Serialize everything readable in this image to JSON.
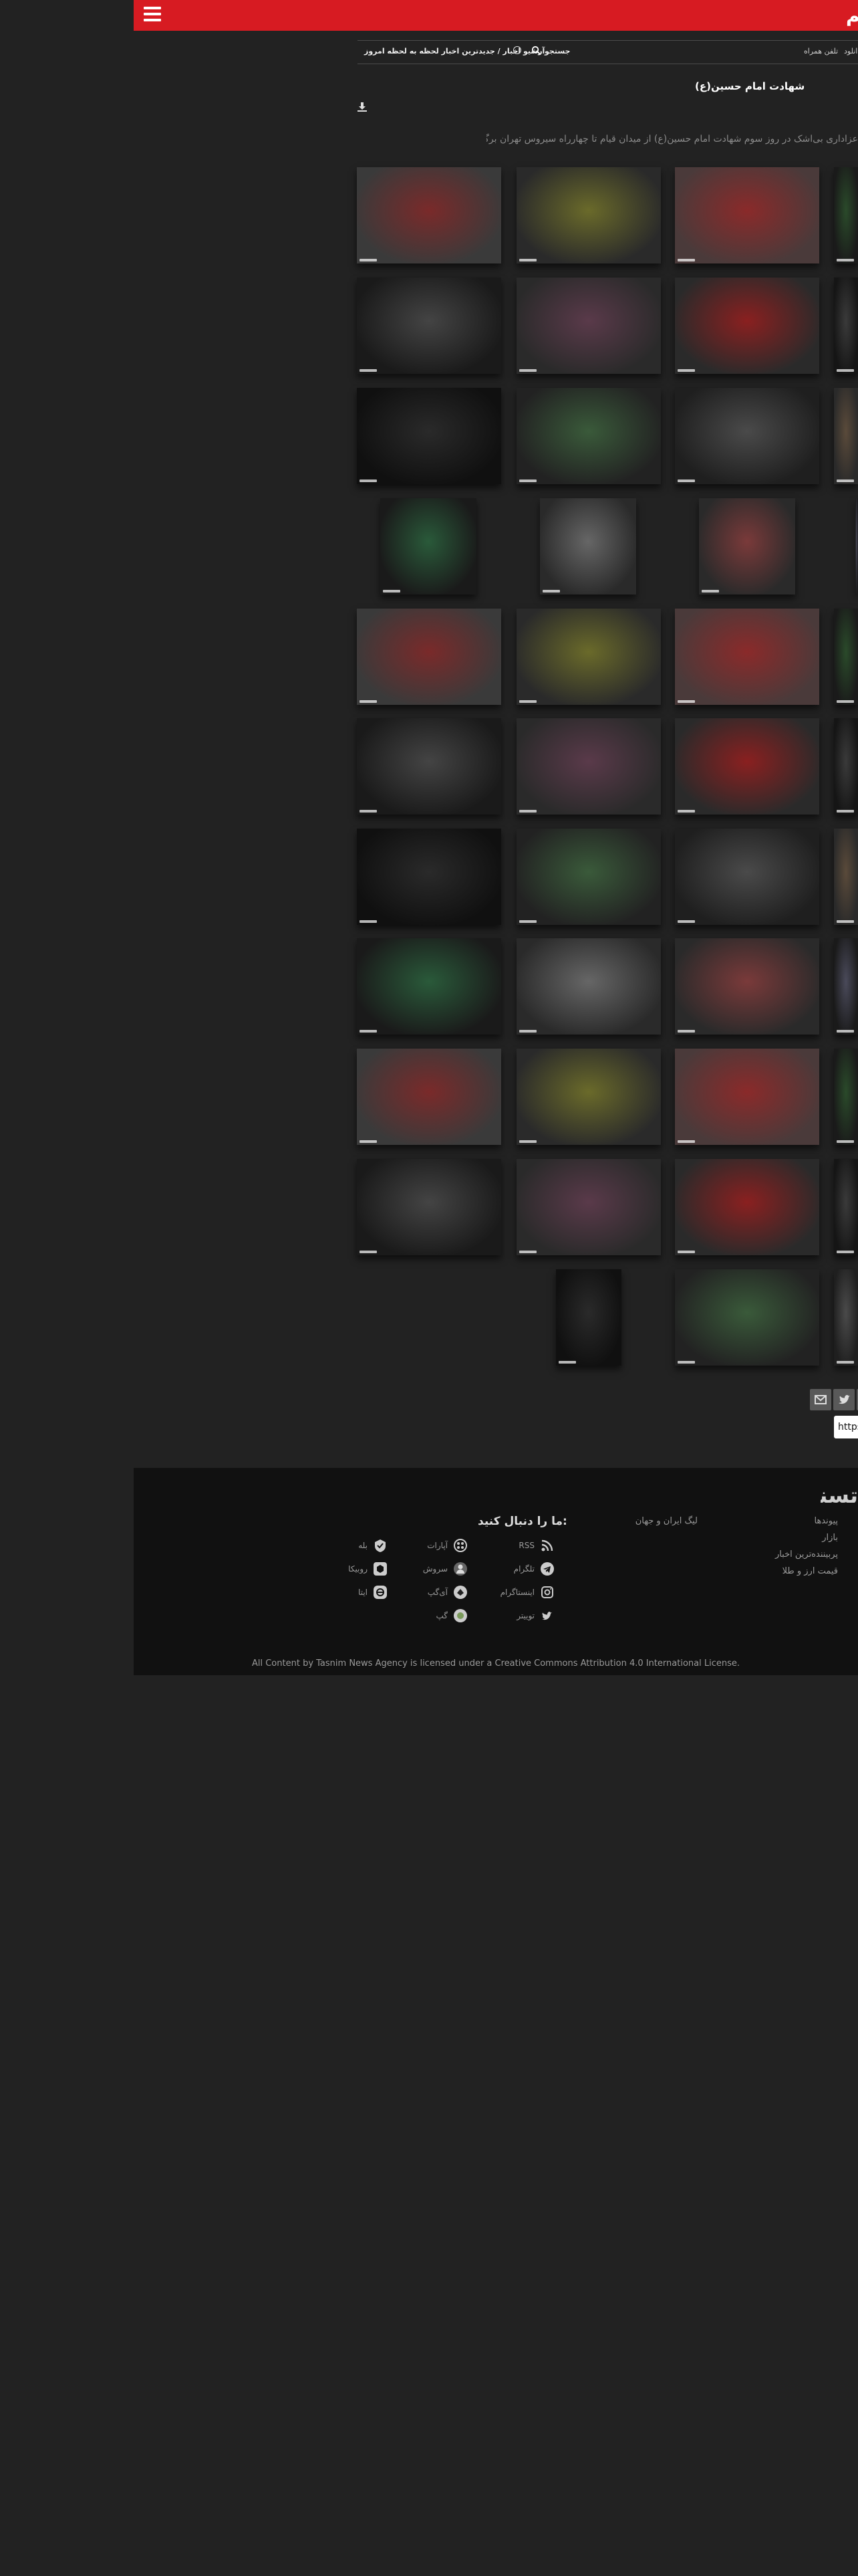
{
  "header": {
    "logo_text": "تسنیم",
    "menu_icon": "hamburger-icon",
    "brand_color": "#d71b22"
  },
  "subnav": {
    "live_label": "آرشیو اخبار / جدیدترین اخبار لحظه به لحظه امروز",
    "search_label": "جستجو",
    "mobile_label": "تلفن همراه",
    "download_label": "دانلود"
  },
  "gallery": {
    "title": "شهادت امام حسین(ع)",
    "lead": "عزاداری بی‌اشک در روز سوم شهادت امام حسین(ع) از میدان قیام تا چهارراه سیروس تهران برگزار شد.",
    "photo_count": 54
  },
  "share": {
    "buttons": [
      "email-icon",
      "twitter-icon",
      "facebook-icon"
    ],
    "url_value": "https://www.tasnimnews.com"
  },
  "footer": {
    "logo_text": "تسنیم",
    "links_col1": [
      "پیوندها",
      "بازار",
      "پربیننده‌ترین اخبار",
      "قیمت ارز و طلا"
    ],
    "links_col2": [
      "لیگ ایران و جهان"
    ],
    "follow_title": "ما را دنبال کنید:",
    "social": [
      {
        "label": "RSS",
        "icon": "rss-icon"
      },
      {
        "label": "تلگرام",
        "icon": "telegram-icon"
      },
      {
        "label": "اینستاگرام",
        "icon": "instagram-icon"
      },
      {
        "label": "توییتر",
        "icon": "twitter-icon"
      },
      {
        "label": "آپارات",
        "icon": "aparat-icon"
      },
      {
        "label": "سروش",
        "icon": "soroush-icon"
      },
      {
        "label": "آی‌گپ",
        "icon": "igap-icon"
      },
      {
        "label": "گپ",
        "icon": "gap-icon"
      },
      {
        "label": "بله",
        "icon": "bale-icon"
      },
      {
        "label": "روبیکا",
        "icon": "rubika-icon"
      },
      {
        "label": "ایتا",
        "icon": "eitaa-icon"
      }
    ],
    "license": "All Content by Tasnim News Agency is licensed under a Creative Commons Attribution 4.0 International License."
  }
}
